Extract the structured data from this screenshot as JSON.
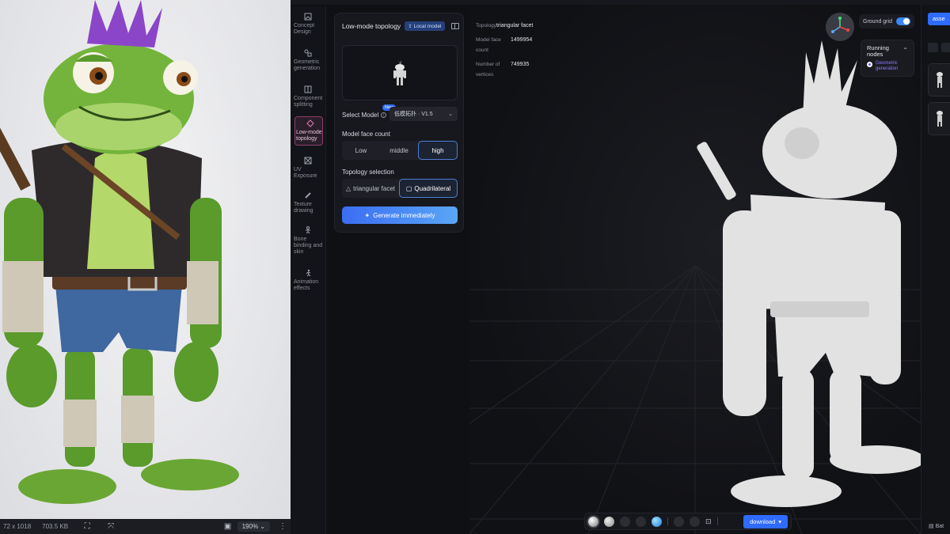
{
  "left_viewer": {
    "dimensions": "72 x 1018",
    "filesize": "703.5 KB",
    "zoom": "190%"
  },
  "sidebar": {
    "items": [
      {
        "label": "Concept Design",
        "icon": "image-icon"
      },
      {
        "label": "Geometric generation",
        "icon": "shapes-icon"
      },
      {
        "label": "Component splitting",
        "icon": "split-icon"
      },
      {
        "label": "Low-mode topology",
        "icon": "topology-icon",
        "active": true
      },
      {
        "label": "UV Exposure",
        "icon": "uv-icon"
      },
      {
        "label": "Texture drawing",
        "icon": "brush-icon"
      },
      {
        "label": "Bone binding and skin",
        "icon": "skeleton-icon"
      },
      {
        "label": "Animation effects",
        "icon": "run-icon"
      }
    ]
  },
  "panel": {
    "title": "Low-mode topology",
    "local_badge": "Local model",
    "select_model_label": "Select Model",
    "new_badge": "New",
    "model_value": "低模拓扑 · V1.5",
    "face_count_label": "Model face count",
    "face_count_options": [
      "Low",
      "middle",
      "high"
    ],
    "face_count_selected": "high",
    "topology_label": "Topology selection",
    "topology_options": [
      "triangular facet",
      "Quadrilateral"
    ],
    "topology_selected": "Quadrilateral",
    "generate_label": "Generate immediately"
  },
  "viewport": {
    "topology_key": "Topology",
    "topology_value": "triangular facet",
    "face_count_key": "Model face count",
    "face_count_value": "1499954",
    "vertices_key": "Number of vertices",
    "vertices_value": "749935",
    "ground_grid_label": "Ground grid",
    "ground_grid_on": true,
    "running_title": "Running nodes",
    "running_node": "Geometric generation",
    "download_label": "download"
  },
  "right_strip": {
    "assets_label": "asse",
    "bottom_label": "Bat"
  },
  "colors": {
    "accent": "#2f6bff",
    "active_nav_border": "#8e3f6a",
    "running_node": "#8f7bff"
  }
}
